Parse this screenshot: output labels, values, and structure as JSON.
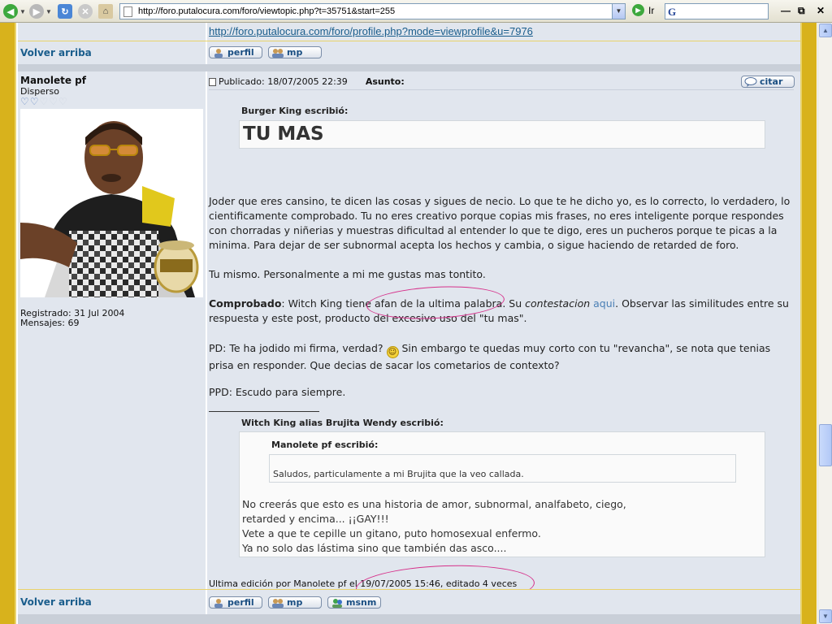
{
  "browser": {
    "url": "http://foro.putalocura.com/foro/viewtopic.php?t=35751&start=255",
    "go_label": "Ir",
    "search_logo": "G"
  },
  "colors": {
    "accent_gold": "#D8B21C",
    "row_bg": "#E1E6EE",
    "link": "#1A5D8C",
    "annotation": "#D6308A"
  },
  "prev_post": {
    "profile_link": "http://foro.putalocura.com/foro/profile.php?mode=viewprofile&u=7976",
    "back_to_top": "Volver arriba",
    "buttons": [
      "perfil",
      "mp"
    ]
  },
  "post": {
    "author": "Manolete pf",
    "rank": "Disperso",
    "registered": "Registrado: 31 Jul 2004",
    "messages": "Mensajes: 69",
    "published": "Publicado: 18/07/2005 22:39",
    "subject_label": "Asunto:",
    "quote_button": "citar",
    "quote1": {
      "title": "Burger King escribió:",
      "body": "TU MAS"
    },
    "para1": "Joder que eres cansino, te dicen las cosas y sigues de necio. Lo que te he dicho yo, es lo correcto, lo verdadero, lo cientificamente comprobado. Tu no eres creativo porque copias mis frases, no eres inteligente porque respondes con chorradas y niñerias y muestras dificultad al entender lo que te digo, eres un pucheros porque te picas a la minima. Para dejar de ser subnormal acepta los hechos y cambia, o sigue haciendo de retarded de foro.",
    "para2": "Tu mismo. Personalmente a mi me gustas mas tontito.",
    "para3": {
      "bold": "Comprobado",
      "text1": ": Witch King tiene afan de la ultima palabra. Su ",
      "italic": "contestacion",
      "space": " ",
      "link": "aqui",
      "text2": ". Observar las similitudes entre su respuesta y este post, producto del excesivo uso del \"tu mas\"."
    },
    "para4": {
      "text1": "PD: Te ha jodido mi firma, verdad? ",
      "text2": " Sin embargo te quedas muy corto con tu \"revancha\", se nota que tenias prisa en responder. Que decias de sacar los cometarios de contexto?"
    },
    "para5": "PPD: Escudo para siempre.",
    "signature": {
      "title": "Witch King alias Brujita Wendy escribió:",
      "inner_title": "Manolete pf escribió:",
      "inner_body": "Saludos, particulamente a mi Brujita que la veo callada.",
      "lines": [
        "No creerás que esto es una historia de amor, subnormal, analfabeto, ciego,",
        "retarded y encima... ¡¡GAY!!!",
        "Vete a que te cepille un gitano, puto homosexual enfermo.",
        "Ya no solo das lástima sino que también das asco...."
      ]
    },
    "edited": "Ultima edición por Manolete pf el 19/07/2005 15:46, editado 4 veces",
    "back_to_top": "Volver arriba",
    "buttons": [
      "perfil",
      "mp",
      "msnm"
    ]
  }
}
